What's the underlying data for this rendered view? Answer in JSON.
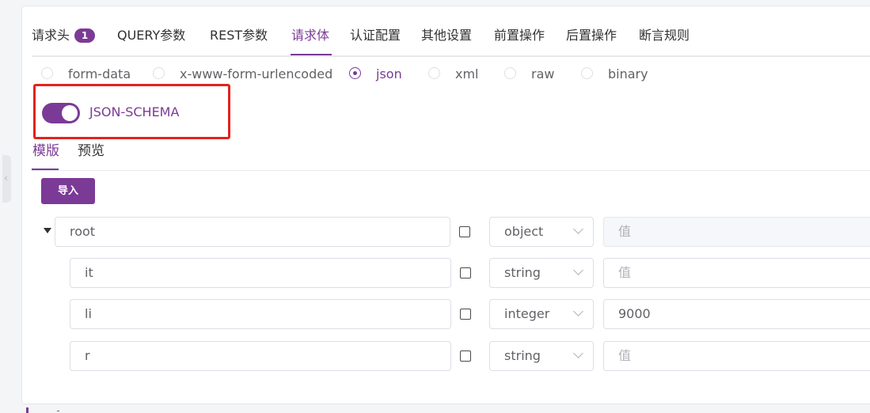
{
  "tabs": {
    "items": [
      {
        "label": "请求头",
        "badge": "1"
      },
      {
        "label": "QUERY参数"
      },
      {
        "label": "REST参数"
      },
      {
        "label": "请求体"
      },
      {
        "label": "认证配置"
      },
      {
        "label": "其他设置"
      },
      {
        "label": "前置操作"
      },
      {
        "label": "后置操作"
      },
      {
        "label": "断言规则"
      }
    ],
    "active": "请求体"
  },
  "body_type": {
    "options": [
      "form-data",
      "x-www-form-urlencoded",
      "json",
      "xml",
      "raw",
      "binary"
    ],
    "selected": "json"
  },
  "json_schema_toggle": {
    "label": "JSON-SCHEMA",
    "on": true
  },
  "subtabs": {
    "items": [
      "模版",
      "预览"
    ],
    "active": "模版"
  },
  "import_button": "导入",
  "schema_rows": [
    {
      "name": "root",
      "type": "object",
      "value": "",
      "value_placeholder": "值",
      "expanded": true,
      "disabled_value": true
    },
    {
      "name": "it",
      "type": "string",
      "value": "",
      "value_placeholder": "值"
    },
    {
      "name": "li",
      "type": "integer",
      "value": "9000",
      "value_placeholder": "值"
    },
    {
      "name": "r",
      "type": "string",
      "value": "",
      "value_placeholder": "值"
    }
  ],
  "colors": {
    "accent": "#7b3a96",
    "highlight": "#e3231c"
  }
}
